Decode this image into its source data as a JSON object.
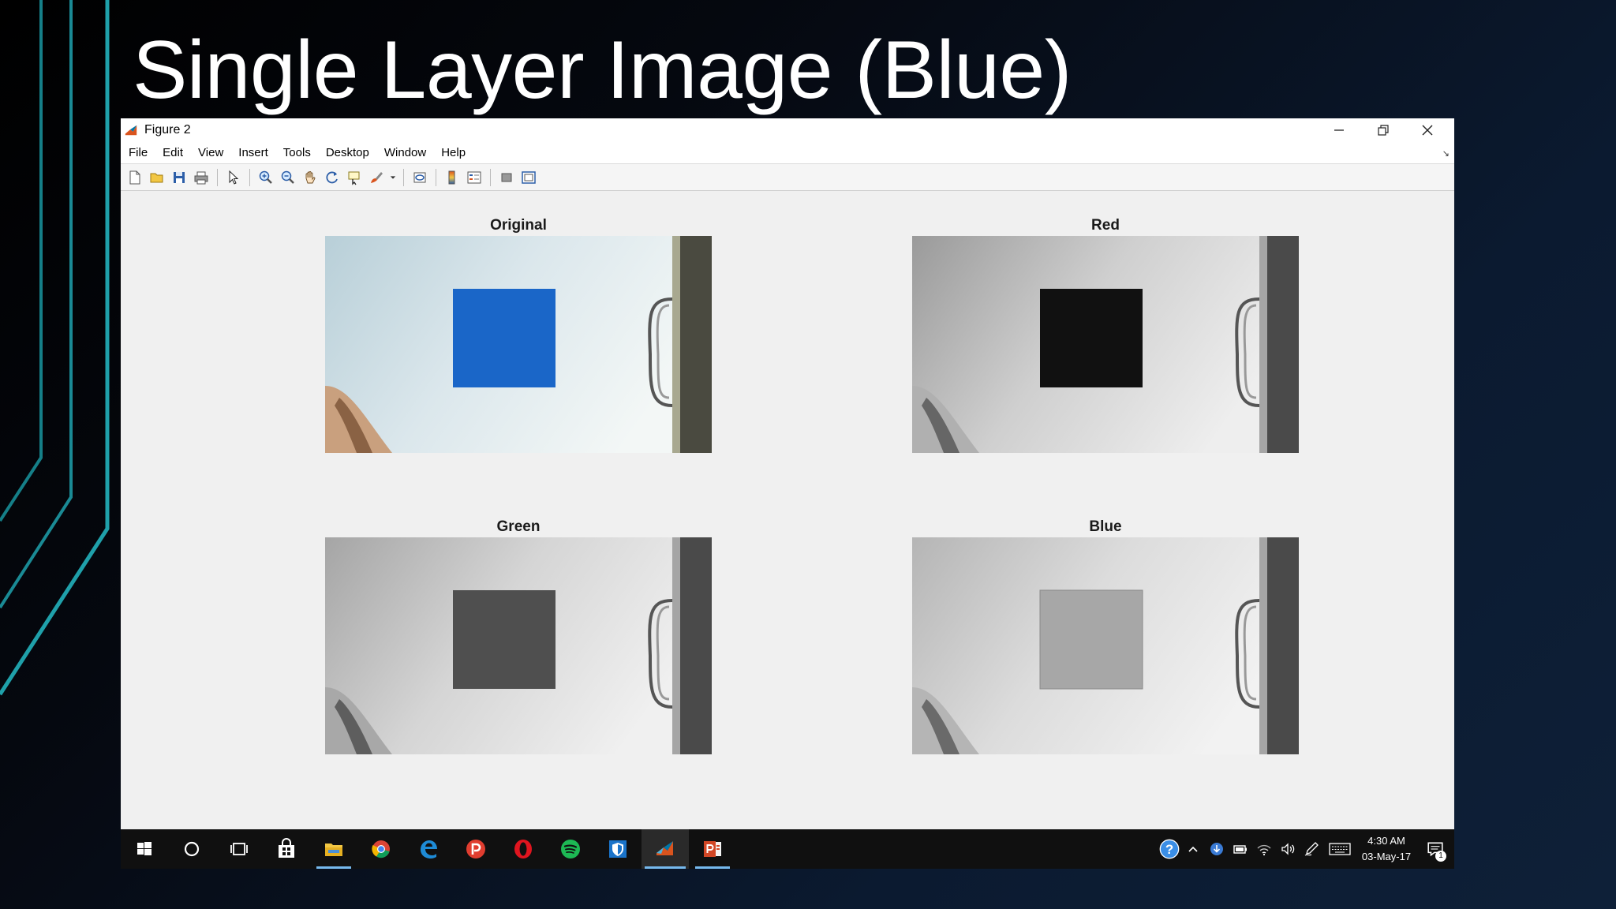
{
  "slide": {
    "title": "Single Layer Image (Blue)"
  },
  "window": {
    "title": "Figure 2",
    "menu": [
      "File",
      "Edit",
      "View",
      "Insert",
      "Tools",
      "Desktop",
      "Window",
      "Help"
    ]
  },
  "figure": {
    "subplots": [
      {
        "title": "Original"
      },
      {
        "title": "Red"
      },
      {
        "title": "Green"
      },
      {
        "title": "Blue"
      }
    ]
  },
  "taskbar": {
    "clock_time": "4:30 AM",
    "clock_date": "03-May-17",
    "notification_count": "1"
  },
  "colors": {
    "accent_teal": "#1a8a95",
    "original_square": "#1a66c8",
    "taskbar_bg": "#101010",
    "taskbar_active": "#76b9ed"
  }
}
